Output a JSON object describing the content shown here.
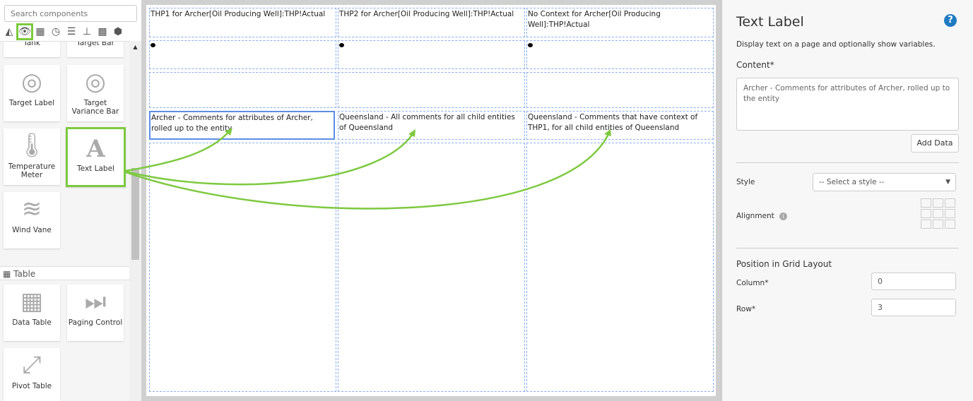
{
  "sidebar": {
    "search_placeholder": "Search components",
    "category_icons": [
      "area-chart-icon",
      "eye-icon",
      "table-icon",
      "clock-icon",
      "sliders-icon",
      "hierarchy-icon",
      "grid-icon",
      "cube-icon"
    ],
    "partial_cards": [
      "Tank",
      "Target Bar"
    ],
    "cards": [
      {
        "label": "Target Label"
      },
      {
        "label": "Target Variance Bar"
      },
      {
        "label": "Temperature Meter"
      },
      {
        "label": "Text Label"
      },
      {
        "label": "Wind Vane"
      }
    ],
    "table_section": "Table",
    "table_cards": [
      {
        "label": "Data Table"
      },
      {
        "label": "Paging Control"
      },
      {
        "label": "Pivot Table"
      }
    ]
  },
  "canvas": {
    "row0": [
      "THP1 for Archer[Oil Producing Well]:THP!Actual",
      "THP2 for Archer[Oil Producing Well]:THP!Actual",
      "No Context for Archer[Oil Producing Well]:THP!Actual"
    ],
    "row3": [
      "Archer - Comments for attributes of Archer, rolled up to the entity",
      "Queensland - All comments for all child entities of Queensland",
      "Queensland - Comments that have context of THP1, for all child entities of Queensland"
    ]
  },
  "panel": {
    "title": "Text Label",
    "description": "Display text on a page and optionally show variables.",
    "content_label": "Content*",
    "content_value": "Archer - Comments for attributes of Archer, rolled up to the entity",
    "add_data": "Add Data",
    "style_label": "Style",
    "style_value": "-- Select a style --",
    "alignment_label": "Alignment",
    "position_heading": "Position in Grid Layout",
    "column_label": "Column*",
    "column_value": "0",
    "row_label": "Row*",
    "row_value": "3"
  },
  "colors": {
    "highlight": "#7dc93f",
    "selection": "#5b8ee6",
    "help": "#1f7bc1"
  }
}
